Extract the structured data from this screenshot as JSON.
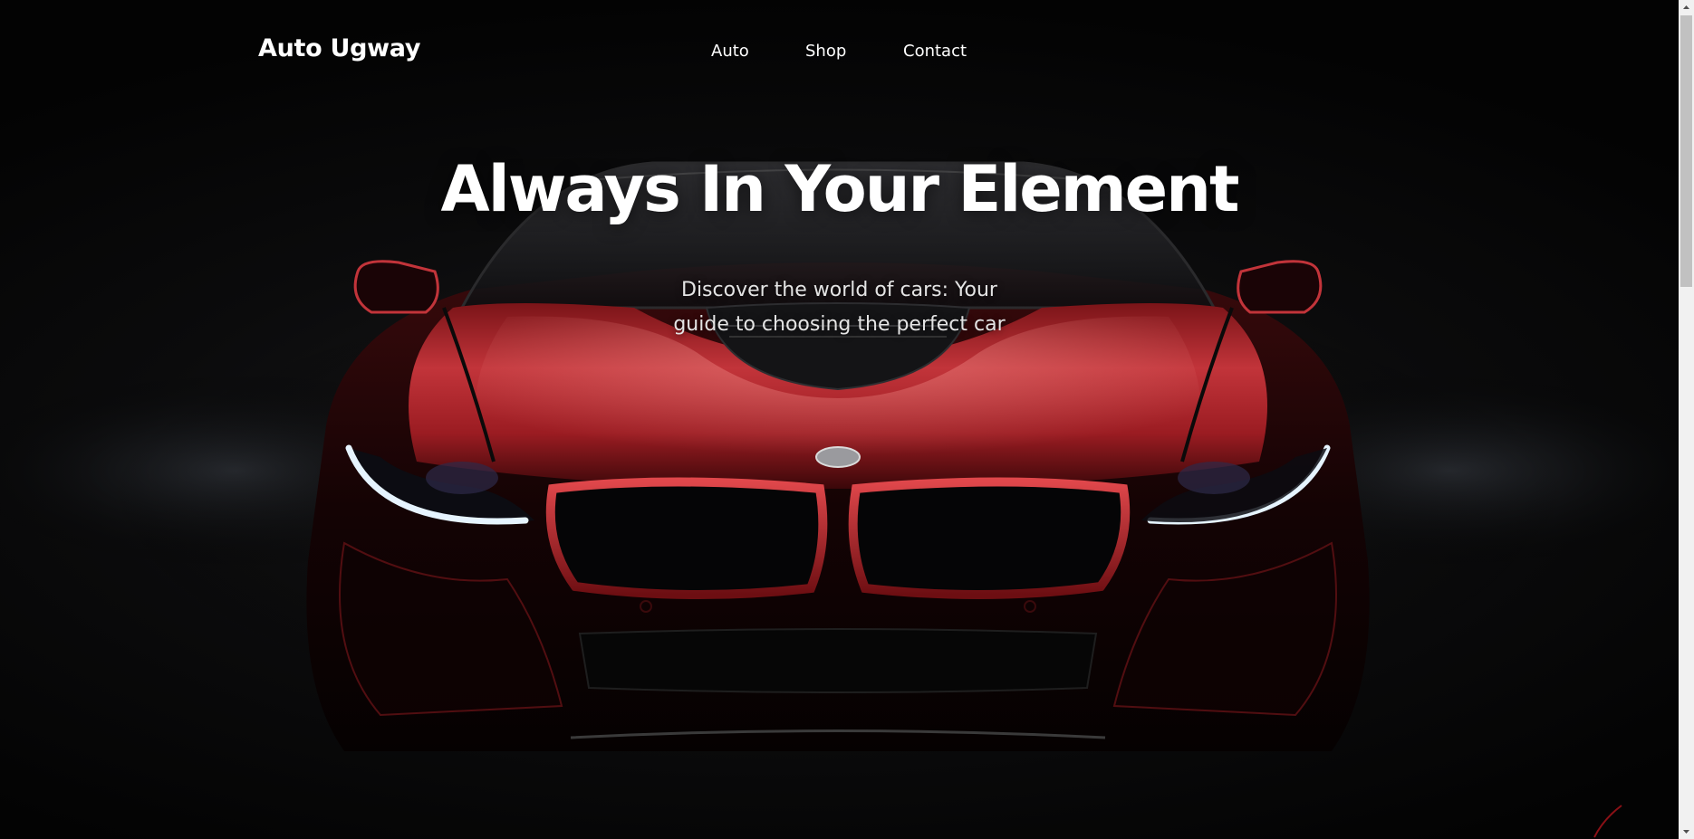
{
  "brand": {
    "name": "Auto Ugway"
  },
  "nav": {
    "items": [
      {
        "label": "Auto"
      },
      {
        "label": "Shop"
      },
      {
        "label": "Contact"
      }
    ]
  },
  "hero": {
    "headline": "Always In Your Element",
    "subline_lines": [
      "Discover the world of cars: Your",
      "guide to choosing the perfect car"
    ],
    "image_icon": "red-sports-car-front-image"
  },
  "colors": {
    "background": "#000000",
    "text": "#ffffff",
    "car_red": "#b8232a",
    "headlight": "#dff3ff"
  },
  "scrollbar": {
    "up_icon": "triangle-up-icon",
    "down_icon": "triangle-down-icon"
  }
}
